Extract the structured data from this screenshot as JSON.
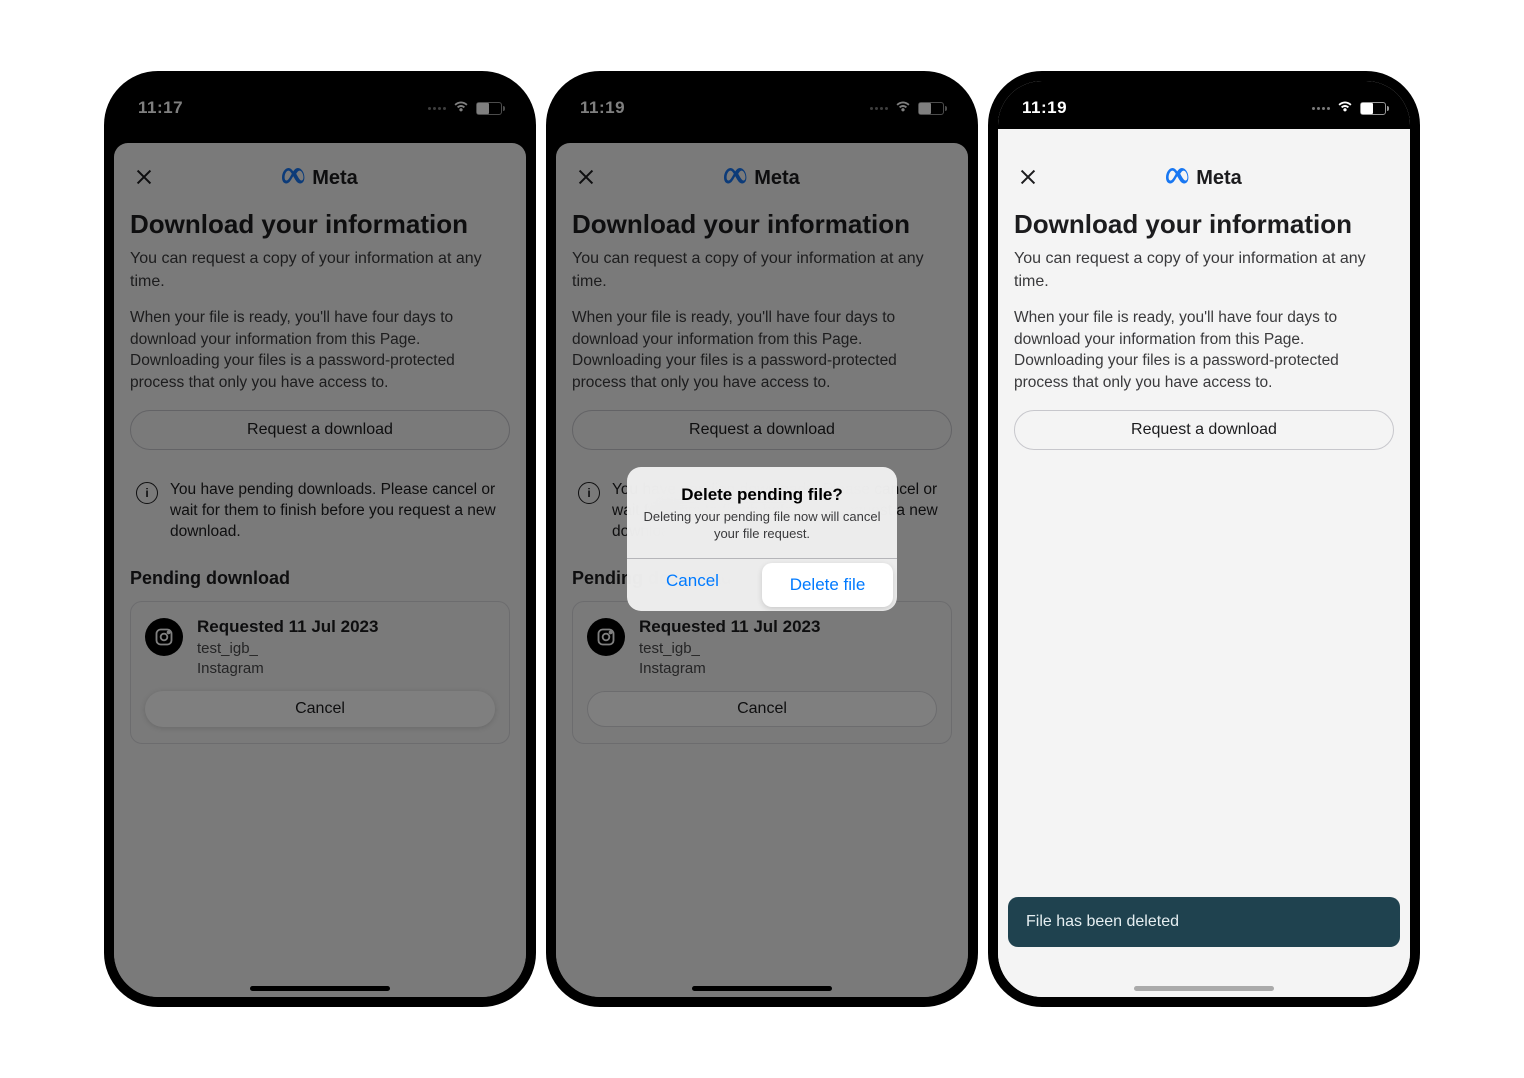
{
  "statusbar": {
    "time_a": "11:17",
    "time_b": "11:19",
    "time_c": "11:19"
  },
  "logo_text": "Meta",
  "page": {
    "title": "Download your information",
    "p1": "You can request a copy of your information at any time.",
    "p2": "When your file is ready, you'll have four days to download your information from this Page. Downloading your files is a password-protected process that only you have access to.",
    "request_btn": "Request a download"
  },
  "info_notice": "You have pending downloads. Please cancel or wait for them to finish before you request a new download.",
  "pending": {
    "heading": "Pending download",
    "requested": "Requested 11 Jul 2023",
    "user": "test_igb_",
    "platform": "Instagram",
    "cancel": "Cancel"
  },
  "alert": {
    "title": "Delete pending file?",
    "message": "Deleting your pending file now will cancel your file request.",
    "cancel": "Cancel",
    "confirm": "Delete file"
  },
  "toast": "File has been deleted"
}
